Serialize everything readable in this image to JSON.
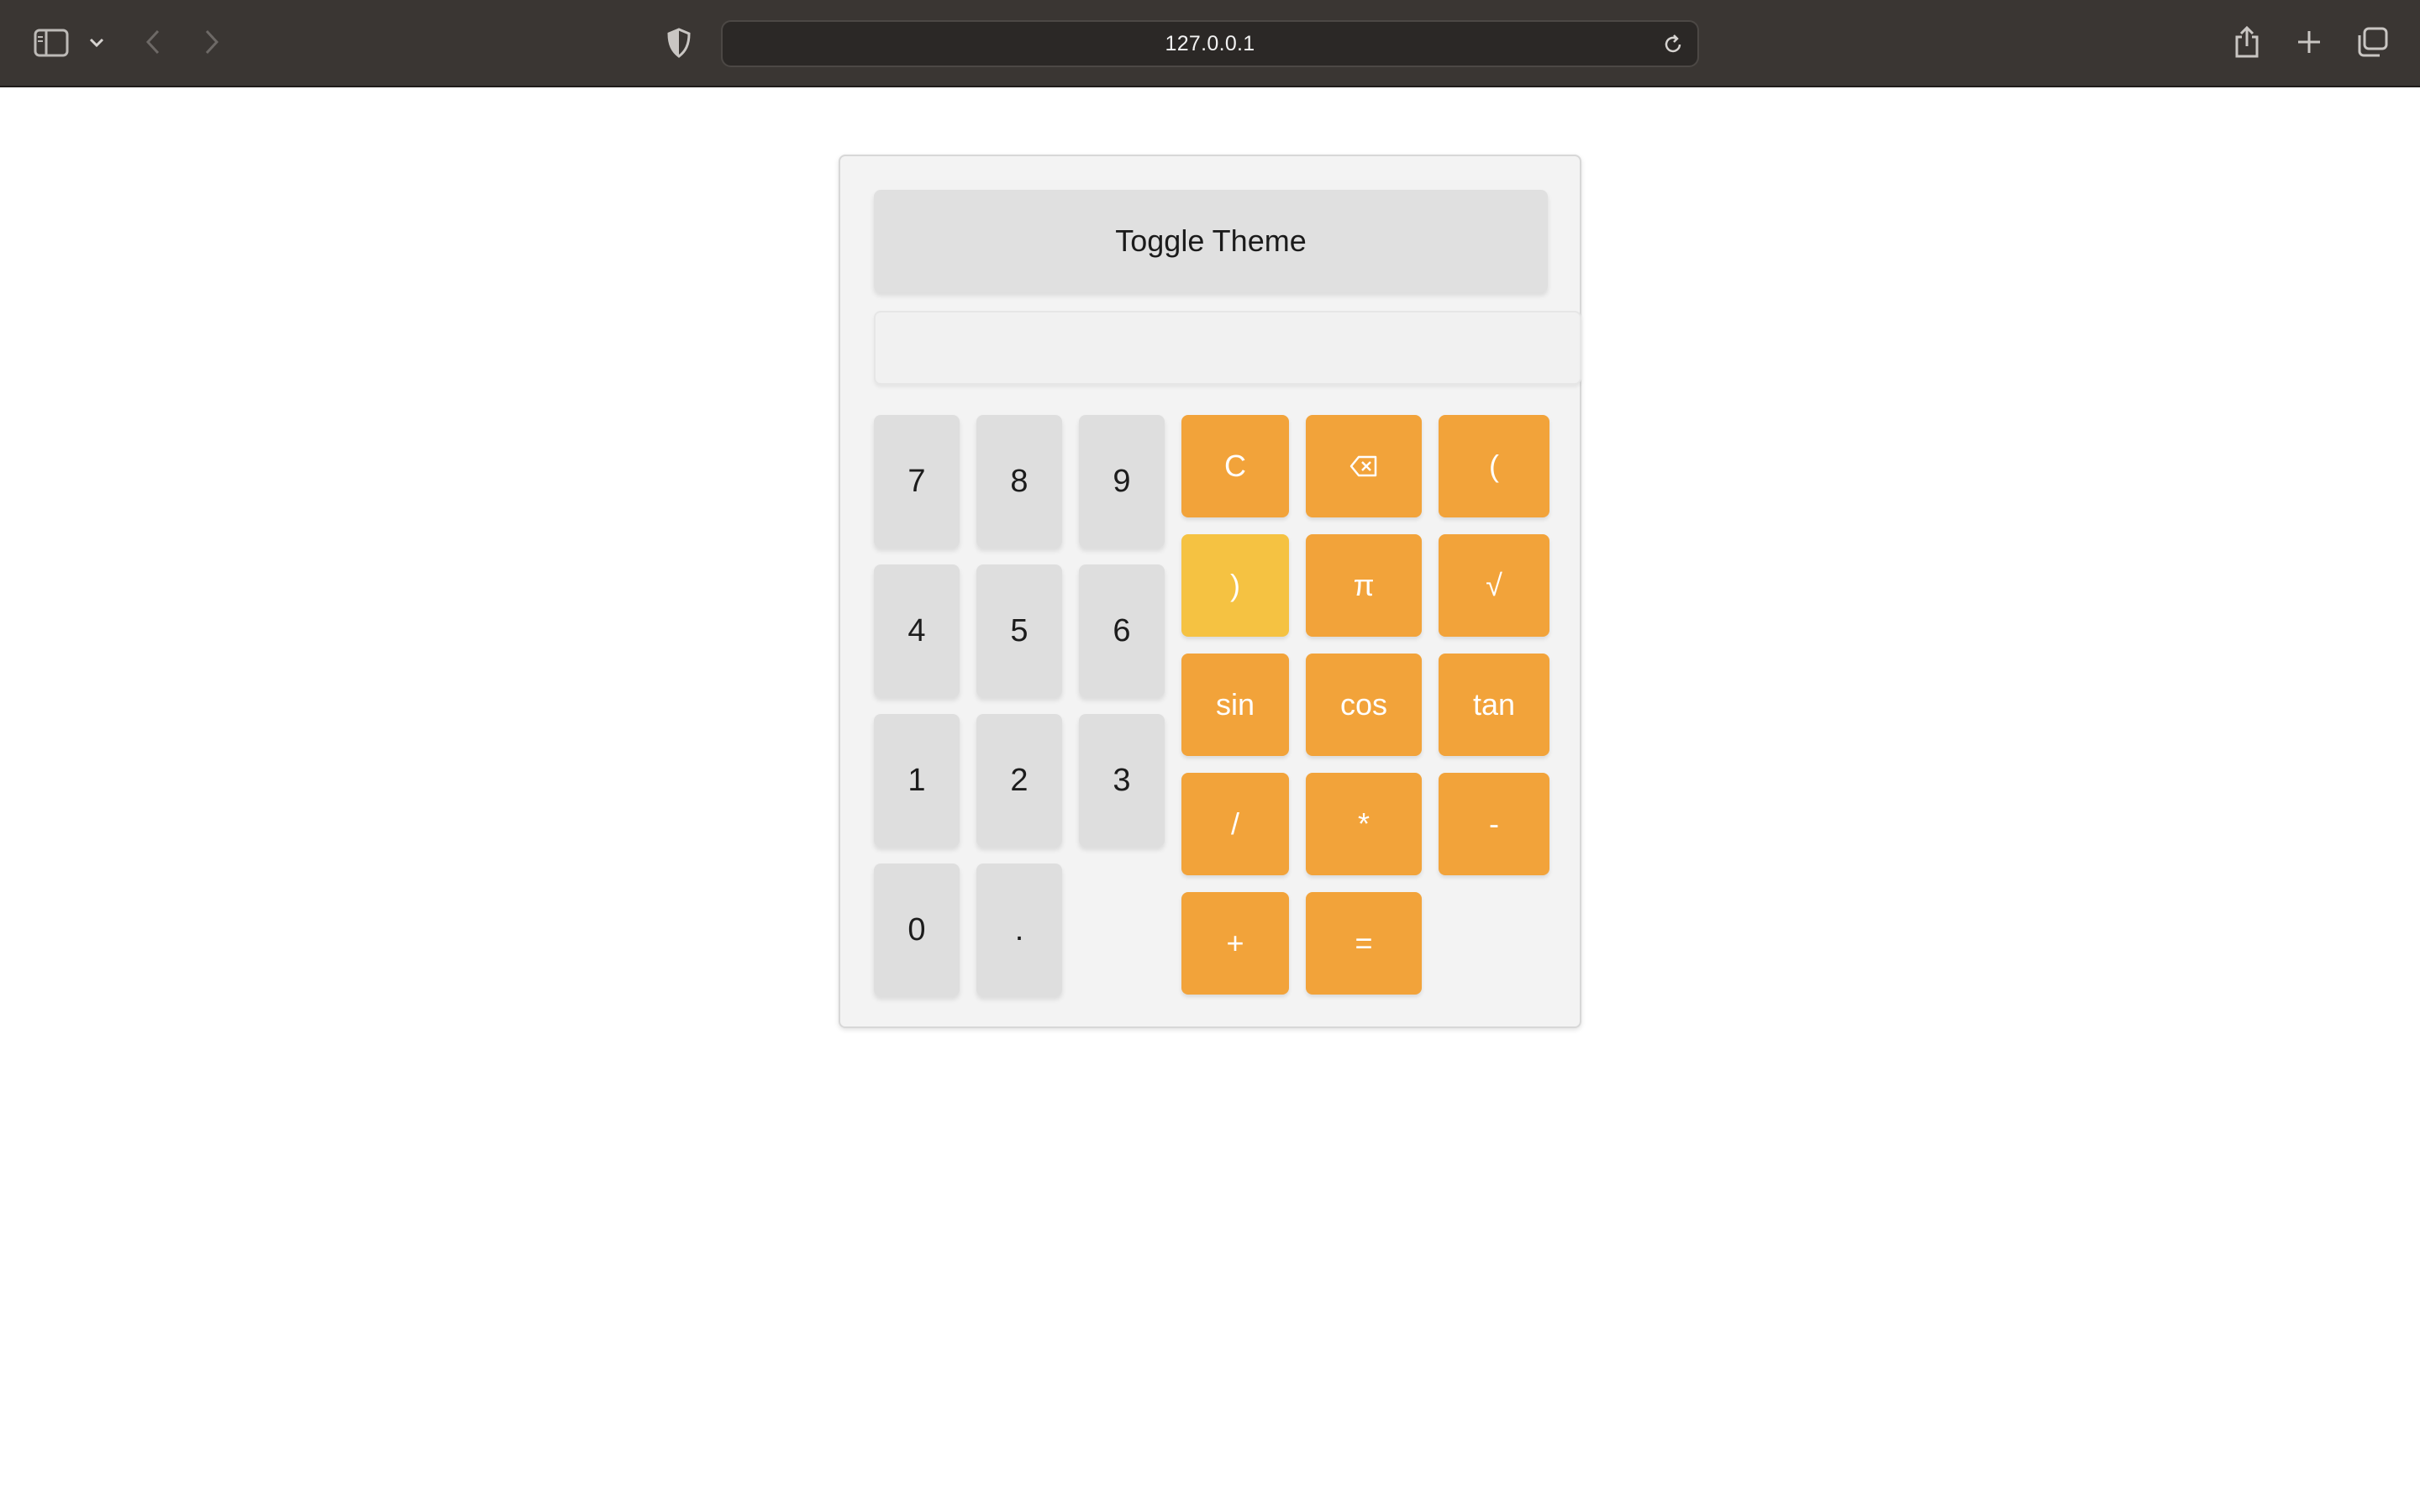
{
  "browser": {
    "url": "127.0.0.1"
  },
  "calculator": {
    "toggle_label": "Toggle Theme",
    "display_value": "",
    "digits": [
      "7",
      "8",
      "9",
      "4",
      "5",
      "6",
      "1",
      "2",
      "3",
      "0",
      "."
    ],
    "ops": {
      "clear": "C",
      "lparen": "(",
      "rparen": ")",
      "pi": "π",
      "sqrt": "√",
      "sin": "sin",
      "cos": "cos",
      "tan": "tan",
      "divide": "/",
      "multiply": "*",
      "minus": "-",
      "plus": "+",
      "equals": "="
    },
    "colors": {
      "digit_key": "#dedede",
      "op_key": "#f2a33a",
      "highlighted_op_key": "#f5c242"
    }
  }
}
